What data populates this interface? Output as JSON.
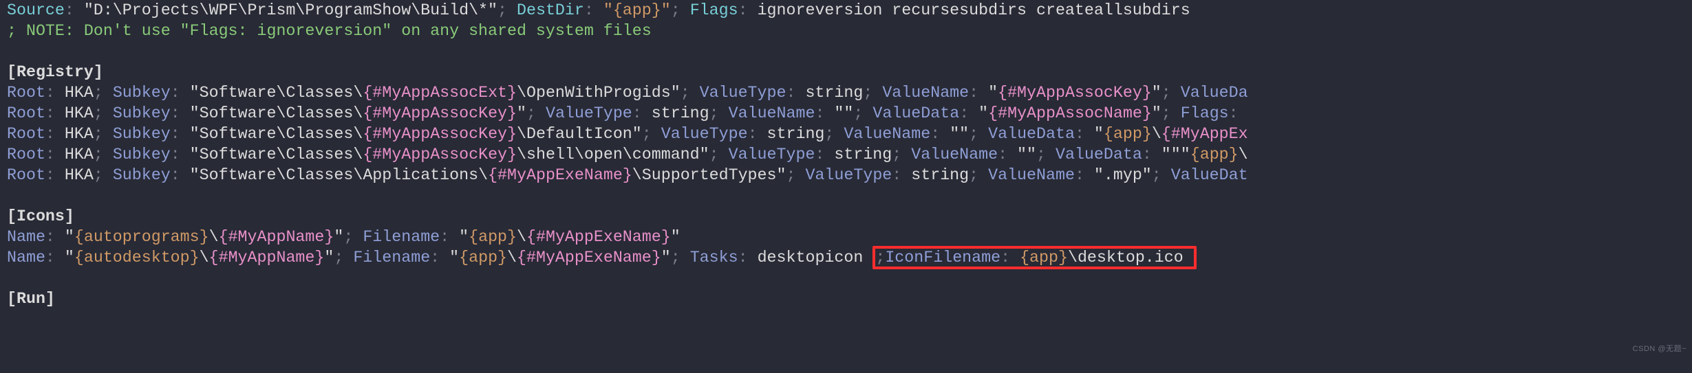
{
  "watermark": "CSDN @无题~",
  "files_section": {
    "line1": {
      "source_key": "Source",
      "source_val": "\"D:\\Projects\\WPF\\Prism\\ProgramShow\\Build\\*\"",
      "destdir_key": "DestDir",
      "destdir_val": "\"{app}\"",
      "flags_key": "Flags",
      "flags_val": "ignoreversion recursesubdirs createallsubdirs"
    },
    "note_marker": "; NOTE:",
    "note_text": " Don't use \"Flags: ignoreversion\" on any shared system files"
  },
  "registry_header": "[Registry]",
  "registry": [
    {
      "root_key": "Root",
      "root_val": "HKA",
      "subkey_key": "Subkey",
      "subkey_pre": "\"Software\\Classes\\",
      "subkey_macro": "{#MyAppAssocExt}",
      "subkey_post": "\\OpenWithProgids\"",
      "vt_key": "ValueType",
      "vt_val": "string",
      "vn_key": "ValueName",
      "vn_val": "\"{#MyAppAssocKey}\"",
      "vd_key": "ValueDa"
    },
    {
      "root_key": "Root",
      "root_val": "HKA",
      "subkey_key": "Subkey",
      "subkey_pre": "\"Software\\Classes\\",
      "subkey_macro": "{#MyAppAssocKey}",
      "subkey_post": "\"",
      "vt_key": "ValueType",
      "vt_val": "string",
      "vn_key": "ValueName",
      "vn_val": "\"\"",
      "vd_key": "ValueData",
      "vd_val": "\"{#MyAppAssocName}\"",
      "flags_key": "Flags",
      "flags_tail": ":"
    },
    {
      "root_key": "Root",
      "root_val": "HKA",
      "subkey_key": "Subkey",
      "subkey_pre": "\"Software\\Classes\\",
      "subkey_macro": "{#MyAppAssocKey}",
      "subkey_post": "\\DefaultIcon\"",
      "vt_key": "ValueType",
      "vt_val": "string",
      "vn_key": "ValueName",
      "vn_val": "\"\"",
      "vd_key": "ValueData",
      "vd_pre": "\"",
      "vd_macro1": "{app}",
      "vd_mid": "\\",
      "vd_macro2": "{#MyAppEx"
    },
    {
      "root_key": "Root",
      "root_val": "HKA",
      "subkey_key": "Subkey",
      "subkey_pre": "\"Software\\Classes\\",
      "subkey_macro": "{#MyAppAssocKey}",
      "subkey_post": "\\shell\\open\\command\"",
      "vt_key": "ValueType",
      "vt_val": "string",
      "vn_key": "ValueName",
      "vn_val": "\"\"",
      "vd_key": "ValueData",
      "vd_pre": "\"\"\"",
      "vd_macro1": "{app}",
      "vd_tail": "\\"
    },
    {
      "root_key": "Root",
      "root_val": "HKA",
      "subkey_key": "Subkey",
      "subkey_pre": "\"Software\\Classes\\Applications\\",
      "subkey_macro": "{#MyAppExeName}",
      "subkey_post": "\\SupportedTypes\"",
      "vt_key": "ValueType",
      "vt_val": "string",
      "vn_key": "ValueName",
      "vn_val": "\".myp\"",
      "vd_key": "ValueDat"
    }
  ],
  "icons_header": "[Icons]",
  "icons": [
    {
      "name_key": "Name",
      "name_pre": "\"",
      "name_macro1": "{autoprograms}",
      "name_mid": "\\",
      "name_macro2": "{#MyAppName}",
      "name_post": "\"",
      "fn_key": "Filename",
      "fn_pre": "\"",
      "fn_macro1": "{app}",
      "fn_mid": "\\",
      "fn_macro2": "{#MyAppExeName}",
      "fn_post": "\""
    },
    {
      "name_key": "Name",
      "name_pre": "\"",
      "name_macro1": "{autodesktop}",
      "name_mid": "\\",
      "name_macro2": "{#MyAppName}",
      "name_post": "\"",
      "fn_key": "Filename",
      "fn_pre": "\"",
      "fn_macro1": "{app}",
      "fn_mid": "\\",
      "fn_macro2": "{#MyAppExeName}",
      "fn_post": "\"",
      "tasks_key": "Tasks",
      "tasks_val": "desktopicon",
      "hl_semicolon": ";",
      "hl_key": "IconFilename",
      "hl_colon": ": ",
      "hl_macro": "{app}",
      "hl_post": "\\desktop.ico"
    }
  ],
  "run_header": "[Run]"
}
